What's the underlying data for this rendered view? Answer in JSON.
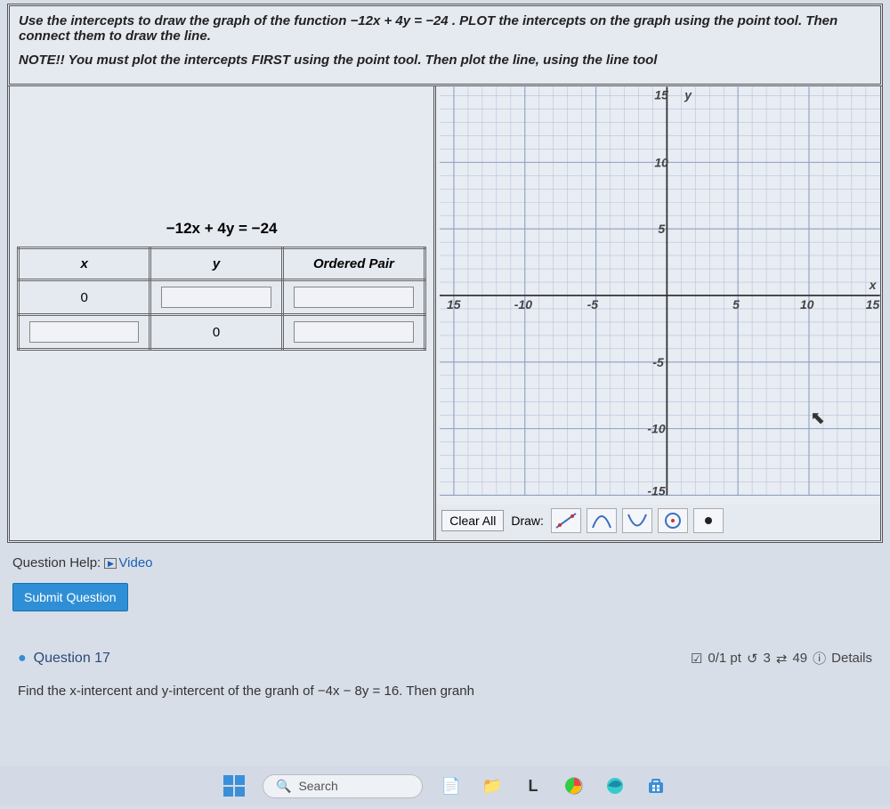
{
  "instructions": {
    "line1_a": "Use the intercepts to draw the graph of the function ",
    "line1_eq": "−12x + 4y = −24",
    "line1_b": ". PLOT the intercepts on the graph using the point tool. Then connect them to draw the line.",
    "note": "NOTE!! You must plot the intercepts FIRST using the point tool. Then plot the line, using the line tool"
  },
  "equation": "−12x + 4y = −24",
  "table": {
    "headers": {
      "x": "x",
      "y": "y",
      "pair": "Ordered Pair"
    },
    "rows": [
      {
        "x": "0",
        "y": "",
        "pair": ""
      },
      {
        "x": "",
        "y": "0",
        "pair": ""
      }
    ]
  },
  "graph": {
    "x_ticks": [
      "15",
      "-10",
      "-5",
      "5",
      "10",
      "15"
    ],
    "y_ticks": [
      "15",
      "10",
      "5",
      "-5",
      "-10",
      "-15"
    ],
    "xlabel": "x",
    "ylabel": "y",
    "toolbar": {
      "clear": "Clear All",
      "draw": "Draw:"
    }
  },
  "help": {
    "label": "Question Help:",
    "video": "Video"
  },
  "submit": "Submit Question",
  "q17": {
    "title": "Question 17",
    "score": "0/1 pt",
    "retries": "3",
    "attempts": "49",
    "details": "Details"
  },
  "partial": "Find the x-intercent and y-intercent of the granh of −4x − 8y = 16. Then granh",
  "taskbar": {
    "search": "Search"
  },
  "chart_data": {
    "type": "scatter",
    "title": "",
    "xlabel": "x",
    "ylabel": "y",
    "xlim": [
      -15,
      15
    ],
    "ylim": [
      -15,
      15
    ],
    "x_ticks": [
      -15,
      -10,
      -5,
      0,
      5,
      10,
      15
    ],
    "y_ticks": [
      -15,
      -10,
      -5,
      0,
      5,
      10,
      15
    ],
    "series": []
  }
}
